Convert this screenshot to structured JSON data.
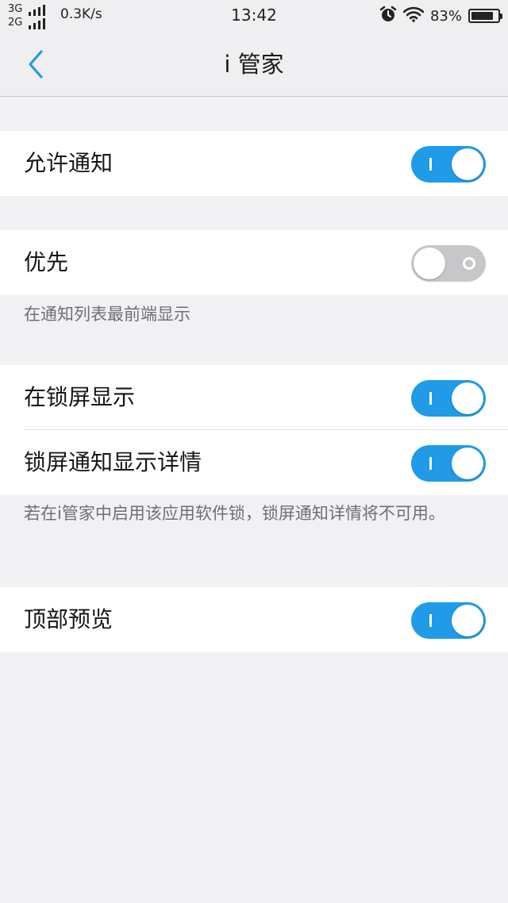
{
  "status_bar": {
    "network_top": "3G",
    "network_bottom": "2G",
    "speed": "0.3K/s",
    "time": "13:42",
    "battery_percent": "83%",
    "battery_level": 0.83,
    "icons": [
      "signal-bars-icon",
      "alarm-clock-icon",
      "wifi-icon",
      "battery-icon"
    ]
  },
  "nav": {
    "back_icon": "chevron-left-icon",
    "title": "i 管家"
  },
  "settings": {
    "allow_notifications": {
      "label": "允许通知",
      "on": true
    },
    "priority": {
      "label": "优先",
      "on": false,
      "description": "在通知列表最前端显示"
    },
    "show_on_lock_screen": {
      "label": "在锁屏显示",
      "on": true
    },
    "lock_screen_details": {
      "label": "锁屏通知显示详情",
      "on": true,
      "description": "若在i管家中启用该应用软件锁，锁屏通知详情将不可用。"
    },
    "top_preview": {
      "label": "顶部预览",
      "on": true
    }
  },
  "colors": {
    "accent": "#1f9be8",
    "toggle_off": "#c7c7c9",
    "background": "#f1f1f3"
  }
}
